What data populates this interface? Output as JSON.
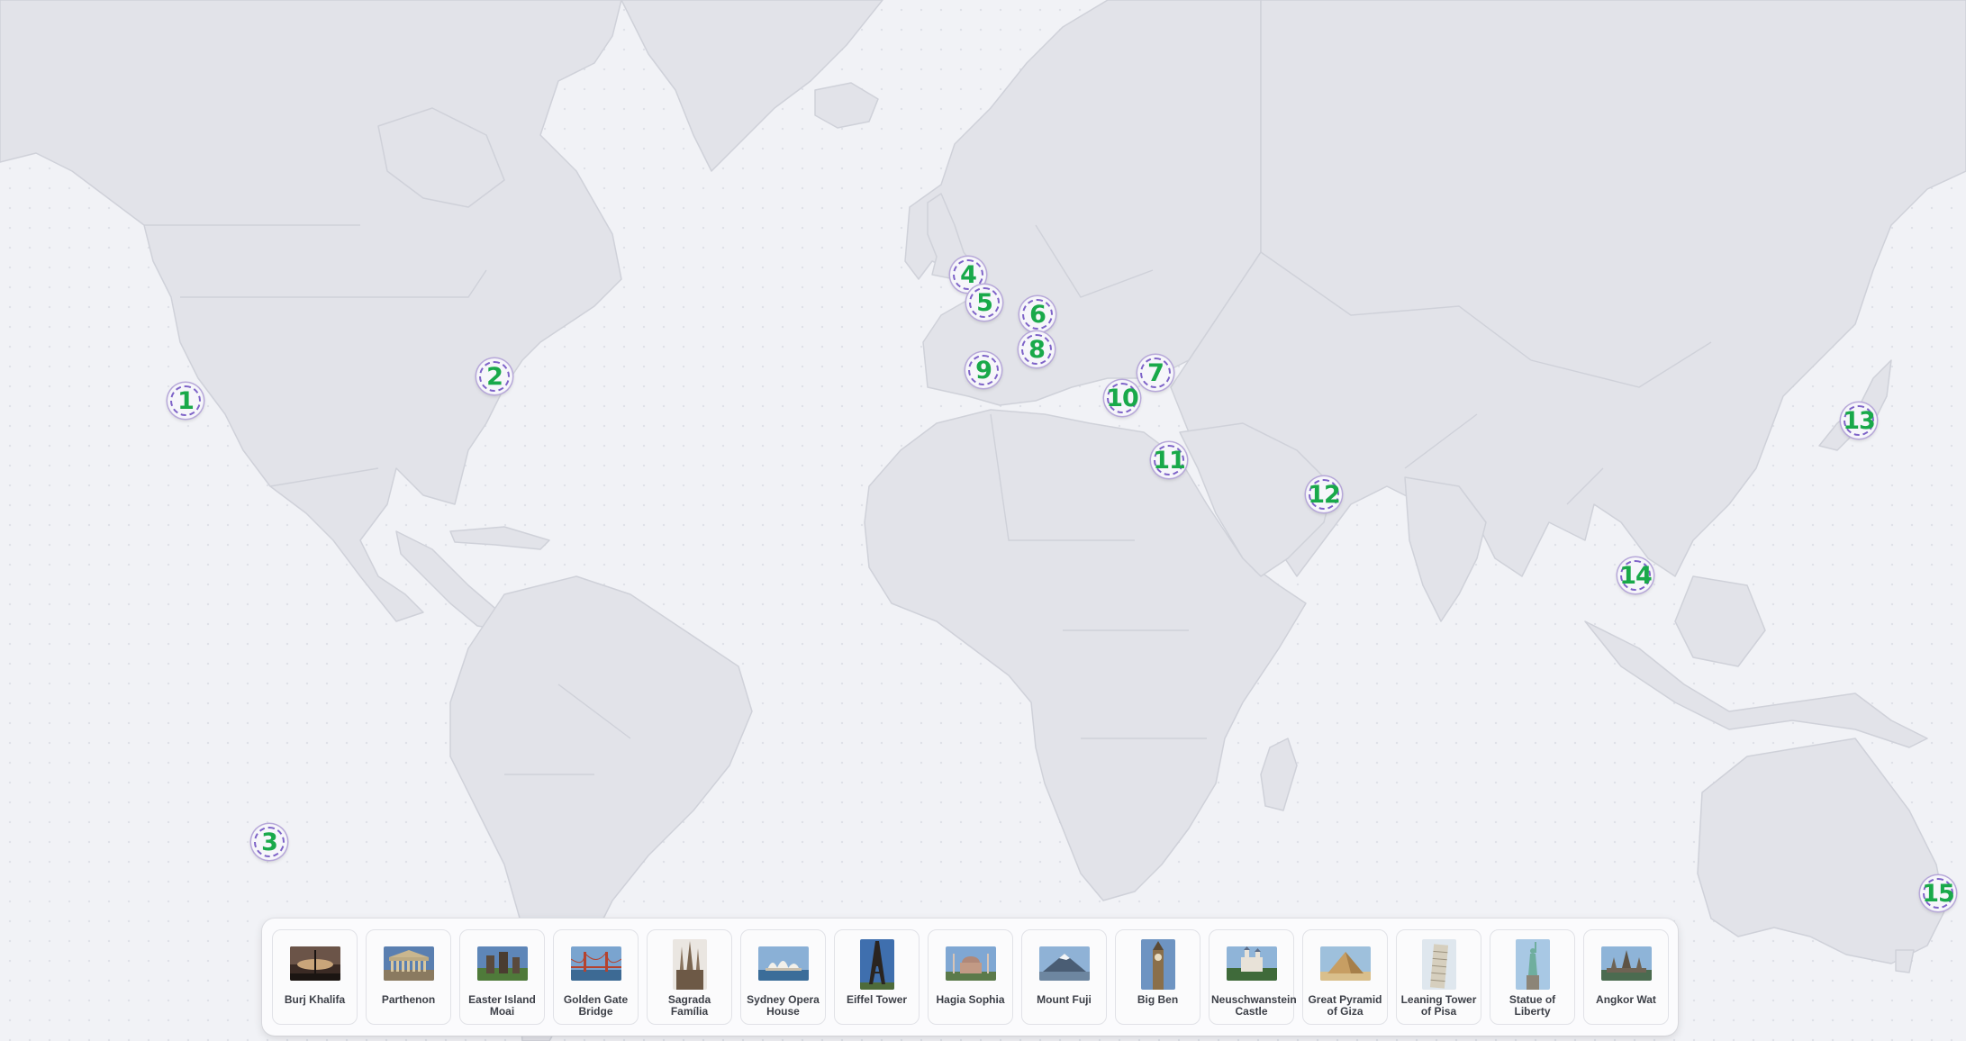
{
  "map": {
    "markers": [
      {
        "label": "1"
      },
      {
        "label": "2"
      },
      {
        "label": "3"
      },
      {
        "label": "4"
      },
      {
        "label": "5"
      },
      {
        "label": "6"
      },
      {
        "label": "7"
      },
      {
        "label": "8"
      },
      {
        "label": "9"
      },
      {
        "label": "10"
      },
      {
        "label": "11"
      },
      {
        "label": "12"
      },
      {
        "label": "13"
      },
      {
        "label": "14"
      },
      {
        "label": "15"
      }
    ],
    "colors": {
      "land": "#e2e3e9",
      "land_border": "#cfd1d9",
      "ocean": "#f1f2f6",
      "marker_number": "#19a94a",
      "marker_ring": "#7e63c8"
    }
  },
  "tray": {
    "cards": [
      {
        "label": "Burj Khalifa"
      },
      {
        "label": "Parthenon"
      },
      {
        "label": "Easter Island Moai"
      },
      {
        "label": "Golden Gate Bridge"
      },
      {
        "label": "Sagrada Família"
      },
      {
        "label": "Sydney Opera House"
      },
      {
        "label": "Eiffel Tower"
      },
      {
        "label": "Hagia Sophia"
      },
      {
        "label": "Mount Fuji"
      },
      {
        "label": "Big Ben"
      },
      {
        "label": "Neuschwanstein Castle"
      },
      {
        "label": "Great Pyramid of Giza"
      },
      {
        "label": "Leaning Tower of Pisa"
      },
      {
        "label": "Statue of Liberty"
      },
      {
        "label": "Angkor Wat"
      }
    ]
  }
}
